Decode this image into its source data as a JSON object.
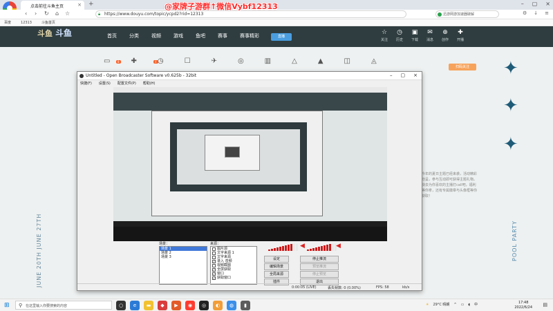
{
  "watermark": "@家牌子游群↑微信Vybf12313",
  "browser": {
    "tab_title": "点击前往斗鱼主页",
    "url": "https://www.douyu.com/topic/ycpd2?rid=12313",
    "search_placeholder": "迅游网游加速器破解",
    "bookmarks": [
      "百度",
      "12313",
      "斗鱼首页"
    ]
  },
  "site": {
    "logo_text": "斗鱼",
    "logo_text2": "斗鱼",
    "nav": [
      "首页",
      "分类",
      "视频",
      "游戏",
      "鱼吧",
      "赛事",
      "赛事精彩"
    ],
    "live_button": "直播",
    "header_tools": [
      {
        "icon": "☆",
        "label": "关注"
      },
      {
        "icon": "◷",
        "label": "历史"
      },
      {
        "icon": "▣",
        "label": "下载"
      },
      {
        "icon": "✉",
        "label": "消息"
      },
      {
        "icon": "⊕",
        "label": "创作"
      },
      {
        "icon": "✚",
        "label": "开播"
      }
    ],
    "right_tag": "扫码关注",
    "right_panel_text": "今年的夏日主题已经来袭，活动精彩纷呈，参与互动即可获得主题礼物。快去为你喜欢的主播打call吧，福利等你拿，还有专属徽章与头像框等你获取！",
    "side_text": "JUNE 20TH JUNE 27TH",
    "pool_party": "POOL PARTY"
  },
  "obs": {
    "title": "Untitled - Open Broadcaster Software v0.625b - 32bit",
    "menu": [
      "快捷(F)",
      "设置(S)",
      "配置文件(P)",
      "帮助(H)"
    ],
    "scenes_label": "场景：",
    "scenes": [
      "场景 1",
      "场景 2",
      "场景 3"
    ],
    "sources_label": "来源：",
    "sources": [
      {
        "label": "图片源",
        "checked": false
      },
      {
        "label": "文字来源 1",
        "checked": false
      },
      {
        "label": "文字来源",
        "checked": false
      },
      {
        "label": "录入 音频",
        "checked": true
      },
      {
        "label": "视频截图",
        "checked": false
      },
      {
        "label": "全屏获取",
        "checked": true
      },
      {
        "label": "窗口",
        "checked": true
      },
      {
        "label": "获取窗口",
        "checked": true
      }
    ],
    "buttons": {
      "settings": "设定",
      "stop_stream": "停止推流",
      "edit_scene": "编辑场景",
      "preview_stream": "预览推流",
      "global_sources": "全局来源",
      "stop_preview": "停止预览",
      "plugins": "插件",
      "exit": "退出"
    },
    "status": {
      "time": "0:00:05 (LIVE)",
      "dropped": "丢失帧数: 0 (0.00%)",
      "fps": "FPS: 58",
      "bitrate": "kb/s"
    }
  },
  "taskbar": {
    "search_placeholder": "在这里输入你要搜索的内容",
    "weather": "29°C 晴朗",
    "lang": "中",
    "time": "17:48",
    "date": "2022/6/24"
  },
  "colors": {
    "site_header": "#2f3d40",
    "accent": "#ff5d23",
    "obs_selection": "#3f78d8",
    "meter_red": "#cc1a1a"
  }
}
